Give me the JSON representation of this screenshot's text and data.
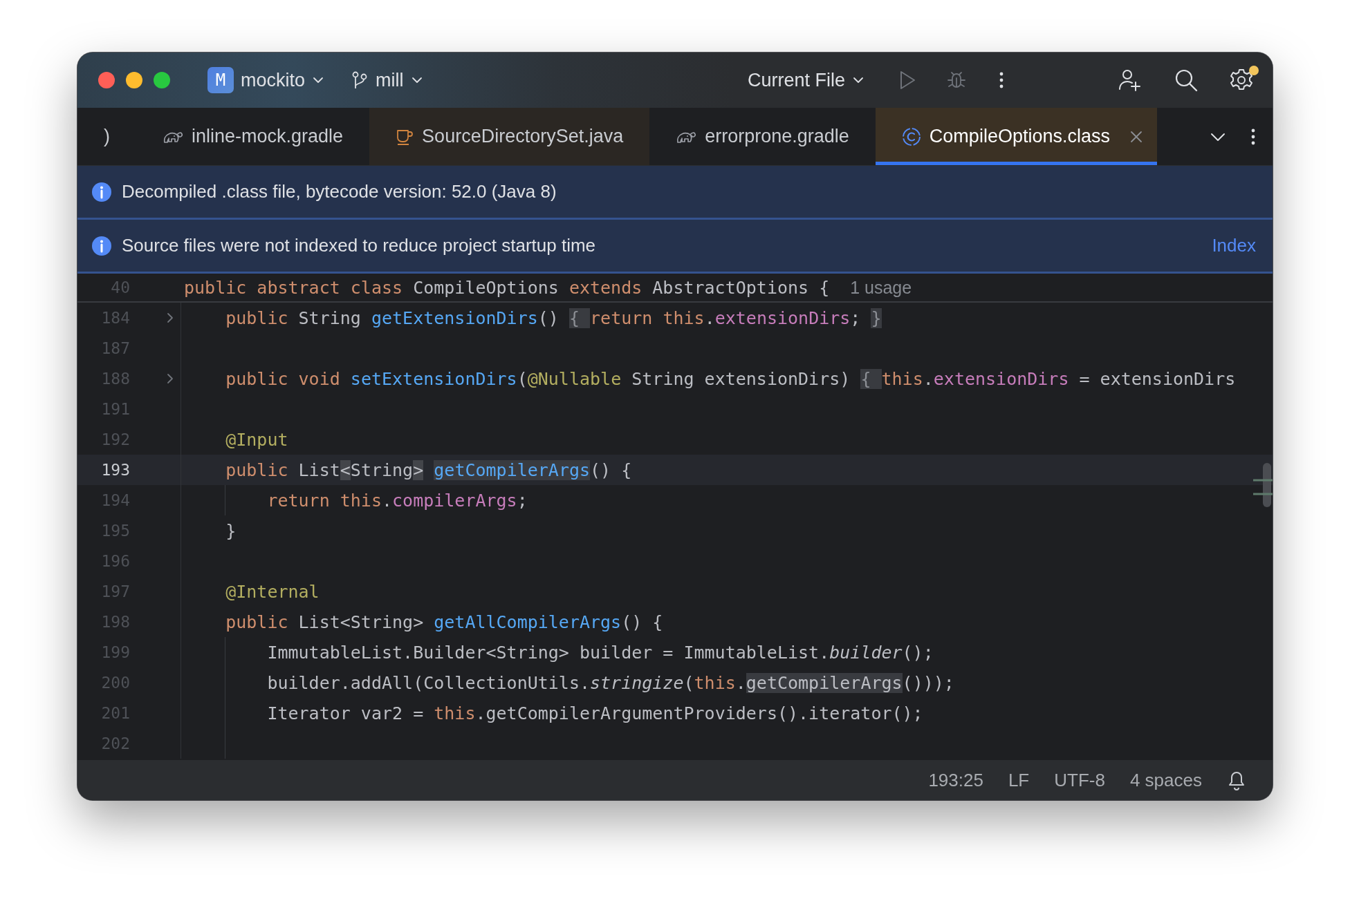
{
  "title_bar": {
    "project": {
      "badge": "M",
      "name": "mockito"
    },
    "branch": "mill",
    "run_config": "Current File",
    "run_enabled": false,
    "settings_badge": true
  },
  "tabs": [
    {
      "label": ")",
      "kind": "unknown",
      "selected": false,
      "color": "#1e1f22"
    },
    {
      "label": "inline-mock.gradle",
      "kind": "gradle",
      "selected": false,
      "color": "#1e1f22"
    },
    {
      "label": "SourceDirectorySet.java",
      "kind": "java",
      "selected": false,
      "color": "#2b2723"
    },
    {
      "label": "errorprone.gradle",
      "kind": "gradle",
      "selected": false,
      "color": "#1e1f22"
    },
    {
      "label": "CompileOptions.class",
      "kind": "class",
      "selected": true,
      "color": "#3b3124"
    }
  ],
  "banners": [
    {
      "text": "Decompiled .class file, bytecode version: 52.0 (Java 8)"
    },
    {
      "text": "Source files were not indexed to reduce project startup time",
      "link": "Index"
    }
  ],
  "sticky_line": {
    "number": "40",
    "hint": "1 usage",
    "tokens": [
      {
        "text": "public abstract class",
        "kind": "keyword"
      },
      {
        "text": " CompileOptions ",
        "kind": "plain"
      },
      {
        "text": "extends",
        "kind": "keyword"
      },
      {
        "text": " AbstractOptions {",
        "kind": "plain"
      }
    ]
  },
  "lines": [
    {
      "number": "184",
      "fold": true,
      "current": false,
      "indent_guide": false,
      "tokens": [
        {
          "text": "    public",
          "kind": "keyword"
        },
        {
          "text": " String ",
          "kind": "plain"
        },
        {
          "text": "getExtensionDirs",
          "kind": "method"
        },
        {
          "text": "()",
          "kind": "plain"
        },
        {
          "text": " { ",
          "kind": "fold-marker"
        },
        {
          "text": "return this",
          "kind": "keyword"
        },
        {
          "text": ".",
          "kind": "plain"
        },
        {
          "text": "extensionDirs",
          "kind": "field"
        },
        {
          "text": ";",
          "kind": "plain"
        },
        {
          "text": " }",
          "kind": "fold-marker"
        }
      ]
    },
    {
      "number": "187",
      "fold": false,
      "current": false,
      "indent_guide": false
    },
    {
      "number": "188",
      "fold": true,
      "current": false,
      "indent_guide": false,
      "tokens": [
        {
          "text": "    public void",
          "kind": "keyword"
        },
        {
          "text": " setExtensionDirs",
          "kind": "method"
        },
        {
          "text": "(",
          "kind": "plain"
        },
        {
          "text": "@Nullable",
          "kind": "annotation"
        },
        {
          "text": " String extensionDirs)",
          "kind": "plain"
        },
        {
          "text": " { ",
          "kind": "fold-marker"
        },
        {
          "text": "this",
          "kind": "keyword"
        },
        {
          "text": ".",
          "kind": "plain"
        },
        {
          "text": "extensionDirs",
          "kind": "field"
        },
        {
          "text": " = extensionDirs",
          "kind": "plain"
        }
      ]
    },
    {
      "number": "191",
      "fold": false,
      "current": false,
      "indent_guide": false
    },
    {
      "number": "192",
      "fold": false,
      "current": false,
      "indent_guide": false,
      "tokens": [
        {
          "text": "    @Input",
          "kind": "annotation"
        }
      ]
    },
    {
      "number": "193",
      "fold": false,
      "current": true,
      "indent_guide": false,
      "tokens": [
        {
          "text": "    public",
          "kind": "keyword"
        },
        {
          "text": " List",
          "kind": "plain"
        },
        {
          "text": "<",
          "kind": "brace-match"
        },
        {
          "text": "String",
          "kind": "plain"
        },
        {
          "text": ">",
          "kind": "brace-match"
        },
        {
          "text": " getCompilerArgs",
          "kind": "method-match"
        },
        {
          "text": "() {",
          "kind": "plain"
        }
      ]
    },
    {
      "number": "194",
      "fold": false,
      "current": false,
      "indent_guide": true,
      "tokens": [
        {
          "text": "        return this",
          "kind": "keyword"
        },
        {
          "text": ".",
          "kind": "plain"
        },
        {
          "text": "compilerArgs",
          "kind": "field"
        },
        {
          "text": ";",
          "kind": "plain"
        }
      ]
    },
    {
      "number": "195",
      "fold": false,
      "current": false,
      "indent_guide": false,
      "tokens": [
        {
          "text": "    }",
          "kind": "plain"
        }
      ]
    },
    {
      "number": "196",
      "fold": false,
      "current": false,
      "indent_guide": false
    },
    {
      "number": "197",
      "fold": false,
      "current": false,
      "indent_guide": false,
      "tokens": [
        {
          "text": "    @Internal",
          "kind": "annotation"
        }
      ]
    },
    {
      "number": "198",
      "fold": false,
      "current": false,
      "indent_guide": false,
      "tokens": [
        {
          "text": "    public",
          "kind": "keyword"
        },
        {
          "text": " List<String> ",
          "kind": "plain"
        },
        {
          "text": "getAllCompilerArgs",
          "kind": "method"
        },
        {
          "text": "() {",
          "kind": "plain"
        }
      ]
    },
    {
      "number": "199",
      "fold": false,
      "current": false,
      "indent_guide": true,
      "tokens": [
        {
          "text": "        ImmutableList.Builder<String> builder = ImmutableList.",
          "kind": "plain"
        },
        {
          "text": "builder",
          "kind": "static-call"
        },
        {
          "text": "();",
          "kind": "plain"
        }
      ]
    },
    {
      "number": "200",
      "fold": false,
      "current": false,
      "indent_guide": true,
      "tokens": [
        {
          "text": "        builder.addAll(CollectionUtils.",
          "kind": "plain"
        },
        {
          "text": "stringize",
          "kind": "static-call"
        },
        {
          "text": "(",
          "kind": "plain"
        },
        {
          "text": "this",
          "kind": "keyword"
        },
        {
          "text": ".",
          "kind": "plain"
        },
        {
          "text": "getCompilerArgs",
          "kind": "usage-match"
        },
        {
          "text": "()));",
          "kind": "plain"
        }
      ]
    },
    {
      "number": "201",
      "fold": false,
      "current": false,
      "indent_guide": true,
      "tokens": [
        {
          "text": "        Iterator var2 = ",
          "kind": "plain"
        },
        {
          "text": "this",
          "kind": "keyword"
        },
        {
          "text": ".getCompilerArgumentProviders().iterator();",
          "kind": "plain"
        }
      ]
    },
    {
      "number": "202",
      "fold": false,
      "current": false,
      "indent_guide": true
    }
  ],
  "status_bar": {
    "items": [
      "193:25",
      "LF",
      "UTF-8",
      "4 spaces"
    ]
  }
}
